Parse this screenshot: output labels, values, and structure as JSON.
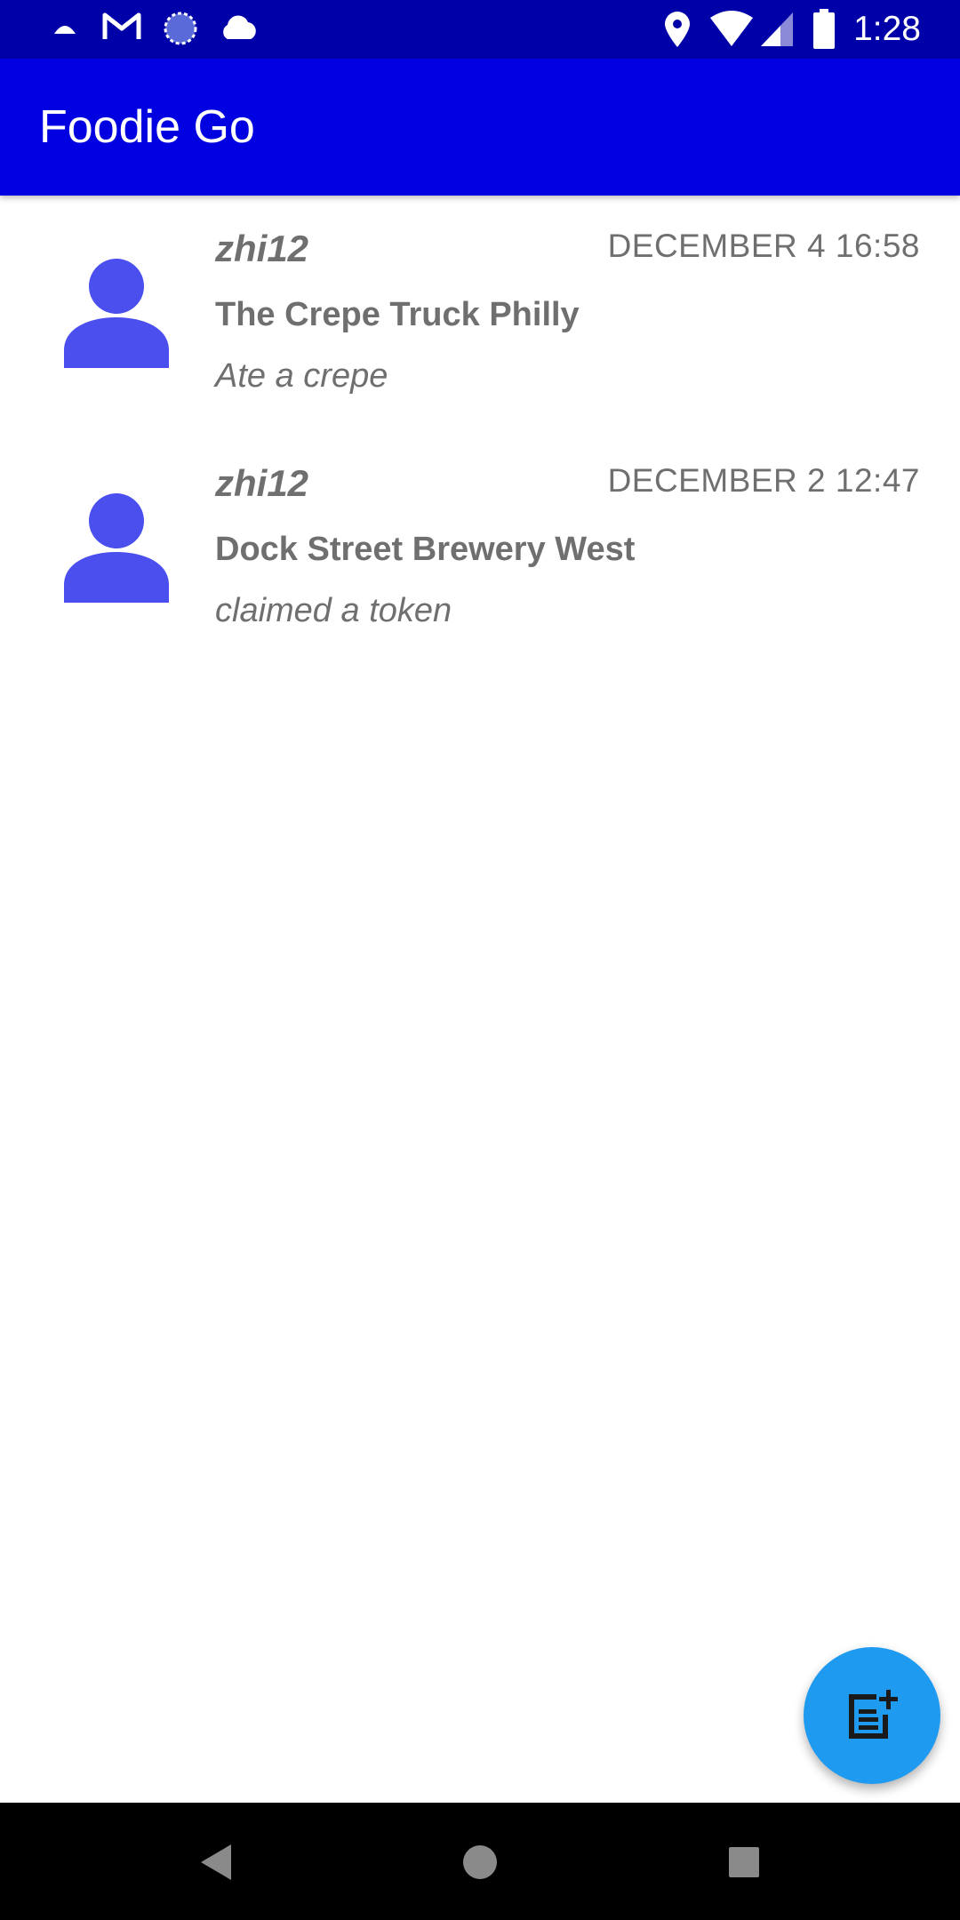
{
  "status_bar": {
    "time": "1:28",
    "icons": [
      "android-notification-icon",
      "gmail-icon",
      "sync-icon",
      "cloud-icon",
      "location-icon",
      "wifi-icon",
      "cell-signal-icon",
      "battery-icon"
    ]
  },
  "app": {
    "title": "Foodie Go"
  },
  "feed": {
    "items": [
      {
        "username": "zhi12",
        "timestamp": "DECEMBER 4 16:58",
        "place": "The Crepe Truck Philly",
        "activity": "Ate a crepe"
      },
      {
        "username": "zhi12",
        "timestamp": "DECEMBER 2 12:47",
        "place": "Dock Street Brewery West",
        "activity": "claimed a token"
      }
    ]
  },
  "fab": {
    "icon": "new-post-icon"
  },
  "nav_bar": {
    "icons": [
      "back-icon",
      "home-icon",
      "recents-icon"
    ]
  },
  "colors": {
    "status_bar": "#0000a8",
    "app_bar": "#0000e0",
    "avatar": "#4a4fee",
    "fab": "#1e9af0",
    "text_secondary": "#6f6f6f"
  }
}
